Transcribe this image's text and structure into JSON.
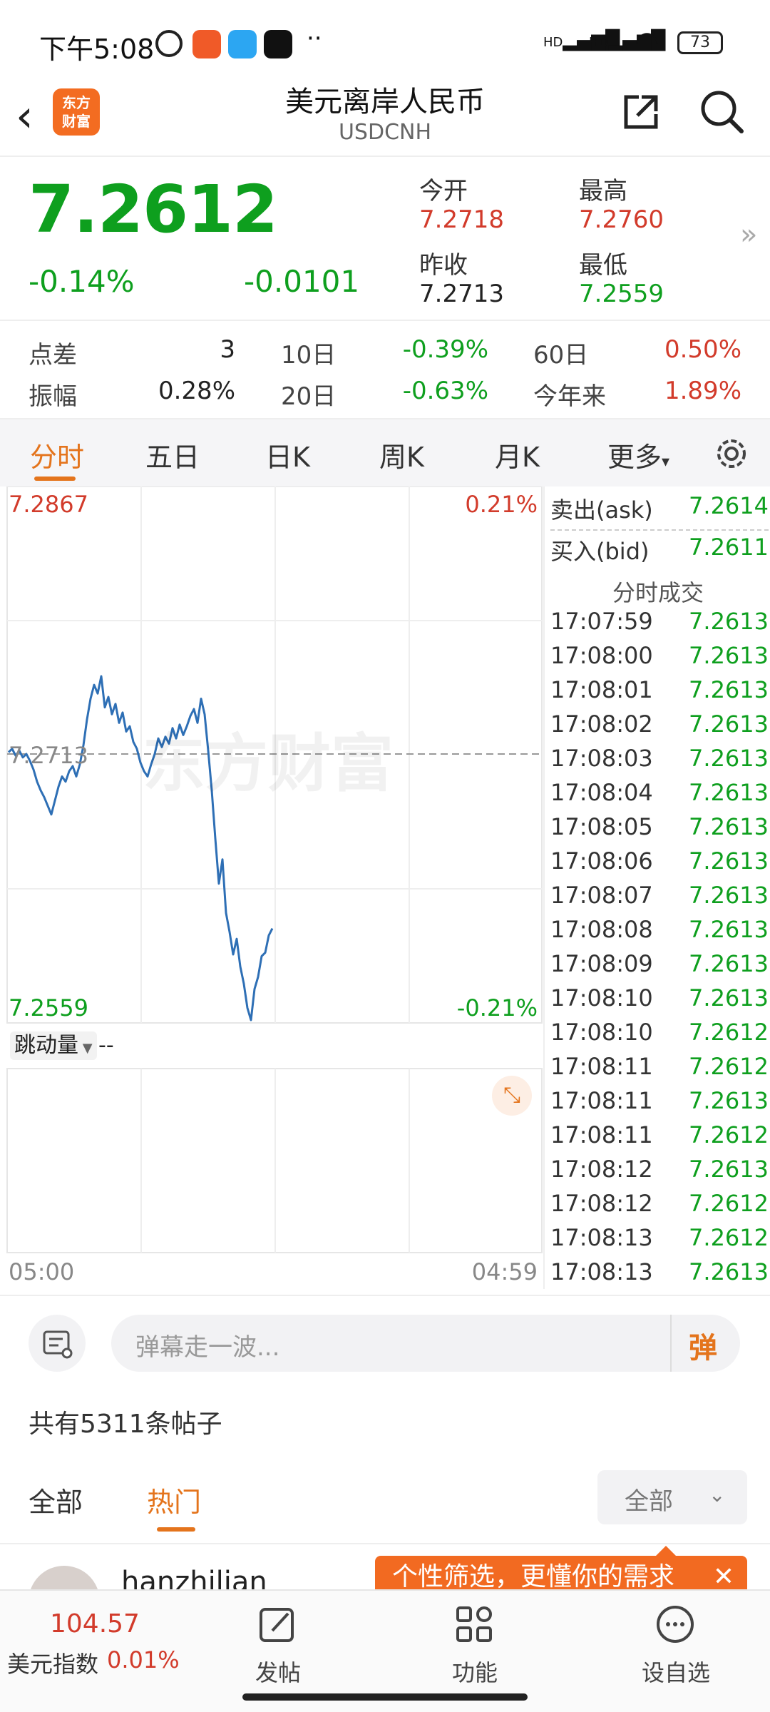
{
  "status_bar": {
    "time": "下午5:08",
    "battery": "73",
    "dots": "··",
    "network_1": "HD",
    "network_2": "HD"
  },
  "header": {
    "back_glyph": "‹",
    "logo_line1": "东方",
    "logo_line2": "财富",
    "title": "美元离岸人民币",
    "subtitle": "USDCNH"
  },
  "quote": {
    "price": "7.2612",
    "change_pct": "-0.14%",
    "change_abs": "-0.0101",
    "open_label": "今开",
    "open": "7.2718",
    "high_label": "最高",
    "high": "7.2760",
    "prev_close_label": "昨收",
    "prev_close": "7.2713",
    "low_label": "最低",
    "low": "7.2559",
    "more_glyph": "»"
  },
  "stats": {
    "spread_label": "点差",
    "spread": "3",
    "amplitude_label": "振幅",
    "amplitude": "0.28%",
    "d10_label": "10日",
    "d10": "-0.39%",
    "d20_label": "20日",
    "d20": "-0.63%",
    "d60_label": "60日",
    "d60": "0.50%",
    "ytd_label": "今年来",
    "ytd": "1.89%"
  },
  "tabs": {
    "items": [
      "分时",
      "五日",
      "日K",
      "周K",
      "月K",
      "更多"
    ],
    "active": "分时",
    "more_caret": "▾"
  },
  "chart": {
    "top_left": "7.2867",
    "top_right": "0.21%",
    "mid_left": "7.2713",
    "bottom_left": "7.2559",
    "bottom_right": "-0.21%",
    "volume_selector": "跳动量",
    "volume_value": "--",
    "time_start": "05:00",
    "time_end": "04:59",
    "watermark": "东方财富",
    "line_color": "#2e6fb5"
  },
  "chart_data": {
    "type": "line",
    "title": "",
    "y_range": [
      7.2559,
      7.2867
    ],
    "reference": 7.2713,
    "series": [
      {
        "values": [
          7.2714,
          7.2716,
          7.2712,
          7.2715,
          7.2711,
          7.2713,
          7.2709,
          7.2704,
          7.2697,
          7.2692,
          7.2688,
          7.2683,
          7.2678,
          7.2686,
          7.2694,
          7.27,
          7.2697,
          7.2703,
          7.2706,
          7.27,
          7.2707,
          7.2718,
          7.2733,
          7.2745,
          7.2753,
          7.2748,
          7.2758,
          7.274,
          7.2746,
          7.2736,
          7.2742,
          7.2731,
          7.2737,
          7.2726,
          7.2729,
          7.272,
          7.2716,
          7.2708,
          7.2703,
          7.27,
          7.2707,
          7.2713,
          7.2722,
          7.2717,
          7.2723,
          7.2719,
          7.2728,
          7.2722,
          7.273,
          7.2724,
          7.2729,
          7.2735,
          7.2739,
          7.2731,
          7.2745,
          7.2736,
          7.2715,
          7.2692,
          7.2664,
          7.2638,
          7.2652,
          7.2621,
          7.261,
          7.2597,
          7.2606,
          7.259,
          7.258,
          7.2566,
          7.2559,
          7.2577,
          7.2584,
          7.2596,
          7.2598,
          7.2608,
          7.2612
        ]
      }
    ]
  },
  "ticks": {
    "ask_label": "卖出(ask)",
    "ask": "7.2614",
    "bid_label": "买入(bid)",
    "bid": "7.2611",
    "header": "分时成交",
    "rows": [
      {
        "t": "17:07:59",
        "p": "7.2613"
      },
      {
        "t": "17:08:00",
        "p": "7.2613"
      },
      {
        "t": "17:08:01",
        "p": "7.2613"
      },
      {
        "t": "17:08:02",
        "p": "7.2613"
      },
      {
        "t": "17:08:03",
        "p": "7.2613"
      },
      {
        "t": "17:08:04",
        "p": "7.2613"
      },
      {
        "t": "17:08:05",
        "p": "7.2613"
      },
      {
        "t": "17:08:06",
        "p": "7.2613"
      },
      {
        "t": "17:08:07",
        "p": "7.2613"
      },
      {
        "t": "17:08:08",
        "p": "7.2613"
      },
      {
        "t": "17:08:09",
        "p": "7.2613"
      },
      {
        "t": "17:08:10",
        "p": "7.2613"
      },
      {
        "t": "17:08:10",
        "p": "7.2612"
      },
      {
        "t": "17:08:11",
        "p": "7.2612"
      },
      {
        "t": "17:08:11",
        "p": "7.2613"
      },
      {
        "t": "17:08:11",
        "p": "7.2612"
      },
      {
        "t": "17:08:12",
        "p": "7.2613"
      },
      {
        "t": "17:08:12",
        "p": "7.2612"
      },
      {
        "t": "17:08:13",
        "p": "7.2612"
      },
      {
        "t": "17:08:13",
        "p": "7.2613"
      }
    ]
  },
  "comment_bar": {
    "placeholder": "弹幕走一波...",
    "danmaku_glyph": "弹"
  },
  "posts": {
    "count_text": "共有5311条帖子",
    "filter_all": "全部",
    "filter_hot": "热门",
    "dropdown": "全部",
    "tooltip": "个性筛选，更懂你的需求",
    "author": "hanzhilian"
  },
  "bottom_nav": {
    "index_value": "104.57",
    "index_name": "美元指数",
    "index_change": "0.01%",
    "post": "发帖",
    "functions": "功能",
    "watchlist": "设自选"
  }
}
